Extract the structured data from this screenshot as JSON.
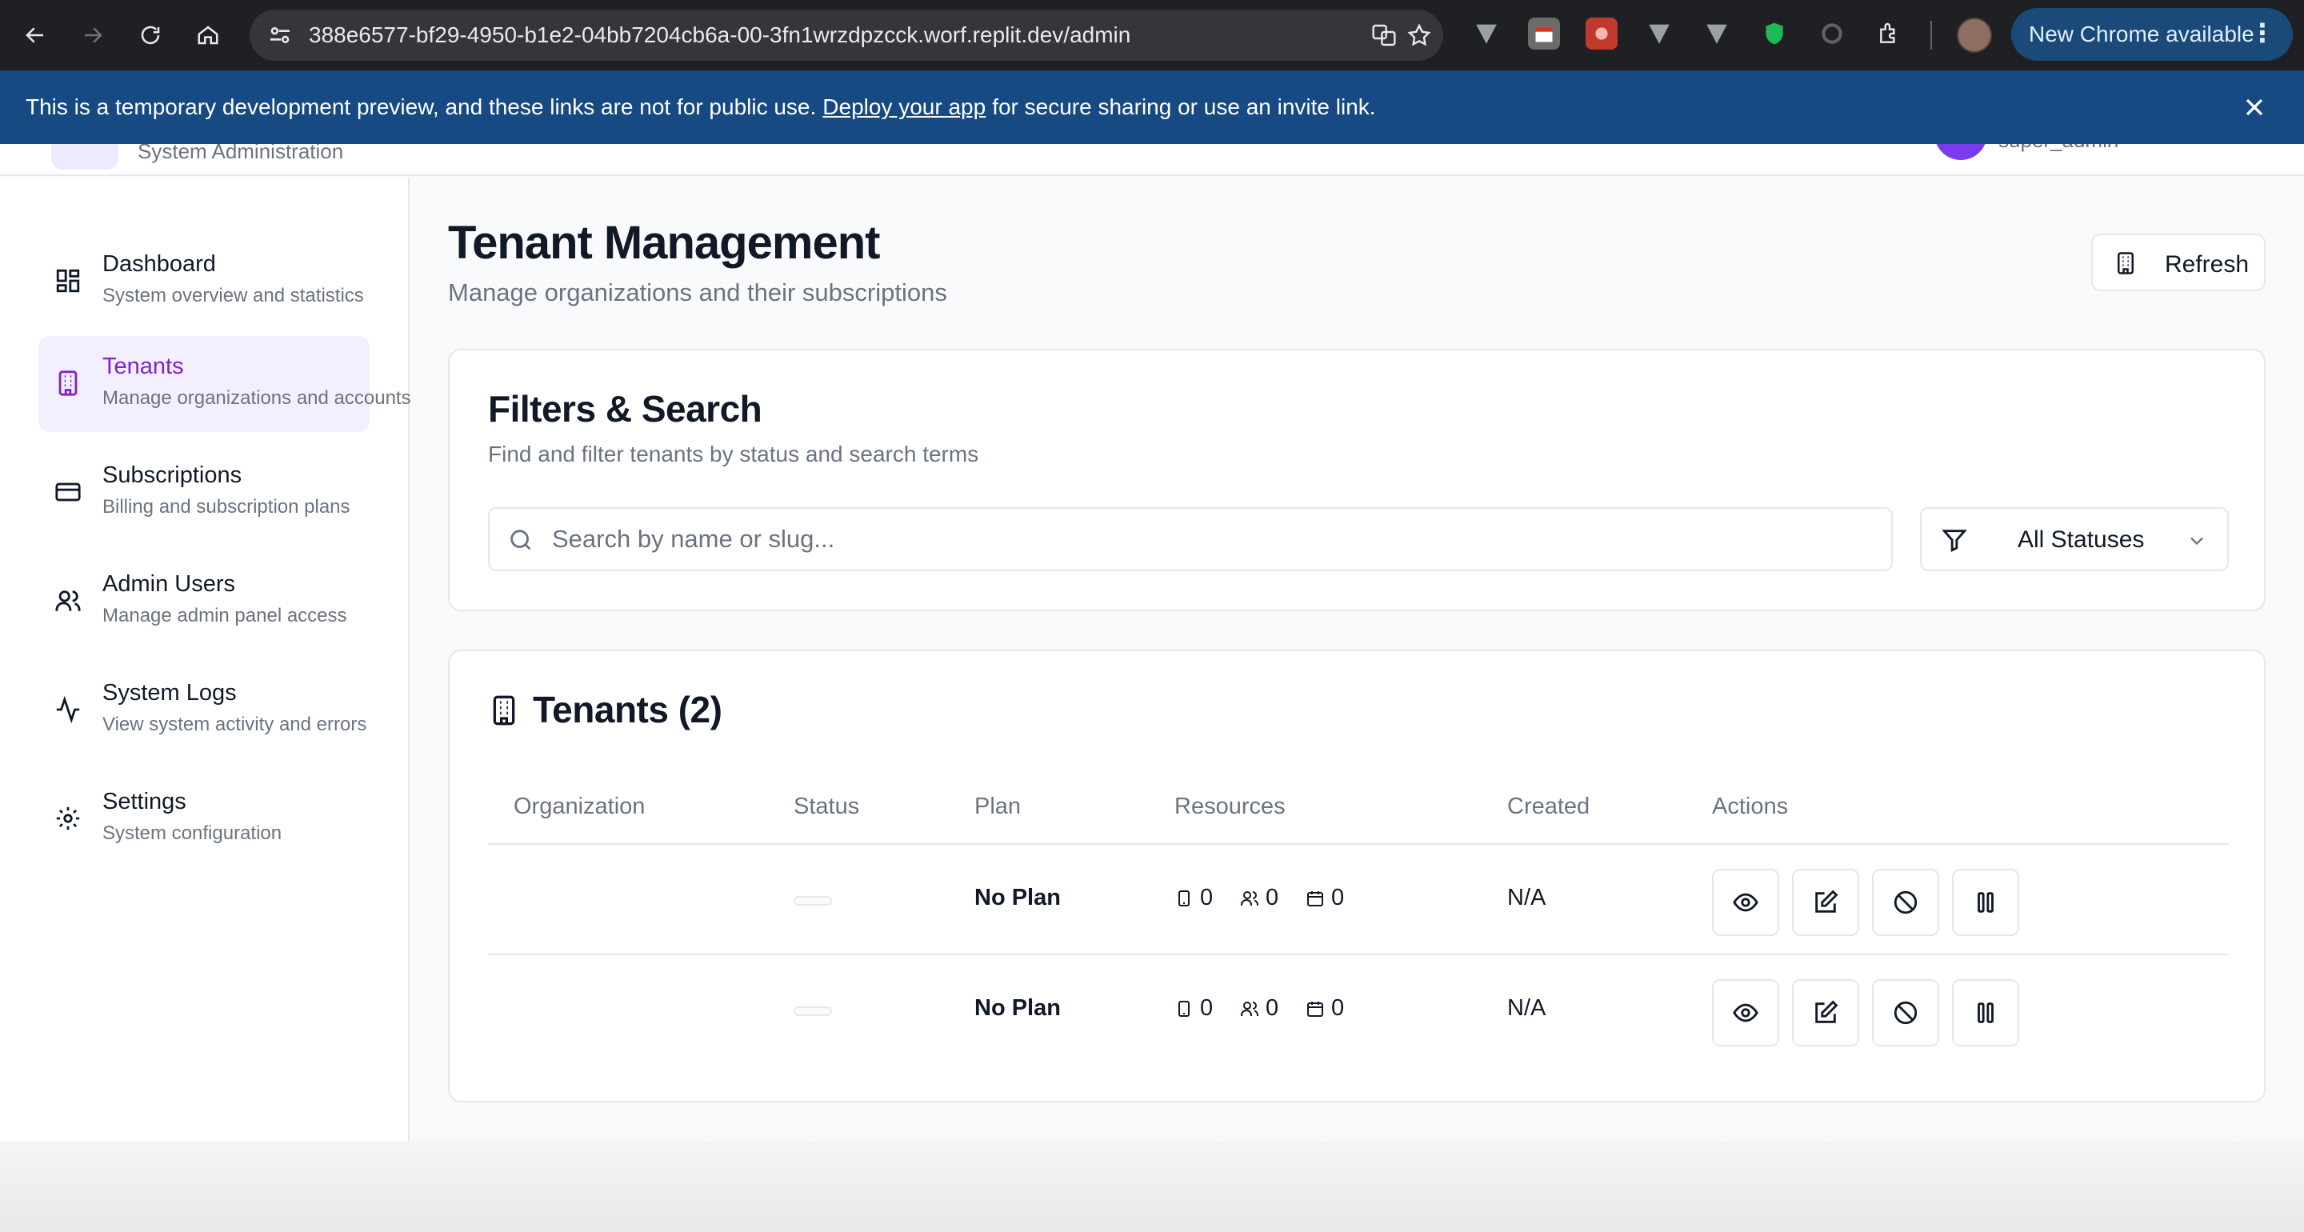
{
  "browser": {
    "url": "388e6577-bf29-4950-b1e2-04bb7204cb6a-00-3fn1wrzdpzcck.worf.replit.dev/admin",
    "update_label": "New Chrome available"
  },
  "banner": {
    "text_before": "This is a temporary development preview, and these links are not for public use.",
    "link": "Deploy your app",
    "text_after": "for secure sharing or use an invite link."
  },
  "app_header": {
    "subtitle": "System Administration",
    "user": "super_admin"
  },
  "sidebar": {
    "items": [
      {
        "label": "Dashboard",
        "desc": "System overview and statistics",
        "icon": "dashboard-icon"
      },
      {
        "label": "Tenants",
        "desc": "Manage organizations and accounts",
        "icon": "building-icon",
        "active": true
      },
      {
        "label": "Subscriptions",
        "desc": "Billing and subscription plans",
        "icon": "credit-card-icon"
      },
      {
        "label": "Admin Users",
        "desc": "Manage admin panel access",
        "icon": "users-icon"
      },
      {
        "label": "System Logs",
        "desc": "View system activity and errors",
        "icon": "activity-icon"
      },
      {
        "label": "Settings",
        "desc": "System configuration",
        "icon": "gear-icon"
      }
    ]
  },
  "page": {
    "title": "Tenant Management",
    "subtitle": "Manage organizations and their subscriptions",
    "refresh_label": "Refresh"
  },
  "filters": {
    "title": "Filters & Search",
    "desc": "Find and filter tenants by status and search terms",
    "search_placeholder": "Search by name or slug...",
    "status_value": "All Statuses"
  },
  "tenants": {
    "title": "Tenants (2)",
    "columns": [
      "Organization",
      "Status",
      "Plan",
      "Resources",
      "Created",
      "Actions"
    ],
    "rows": [
      {
        "organization": "",
        "plan": "No Plan",
        "devices": "0",
        "users": "0",
        "events": "0",
        "created": "N/A"
      },
      {
        "organization": "",
        "plan": "No Plan",
        "devices": "0",
        "users": "0",
        "events": "0",
        "created": "N/A"
      }
    ]
  },
  "colors": {
    "accent": "#7e22ce",
    "active_bg": "#f3effe",
    "banner": "#174a82"
  }
}
